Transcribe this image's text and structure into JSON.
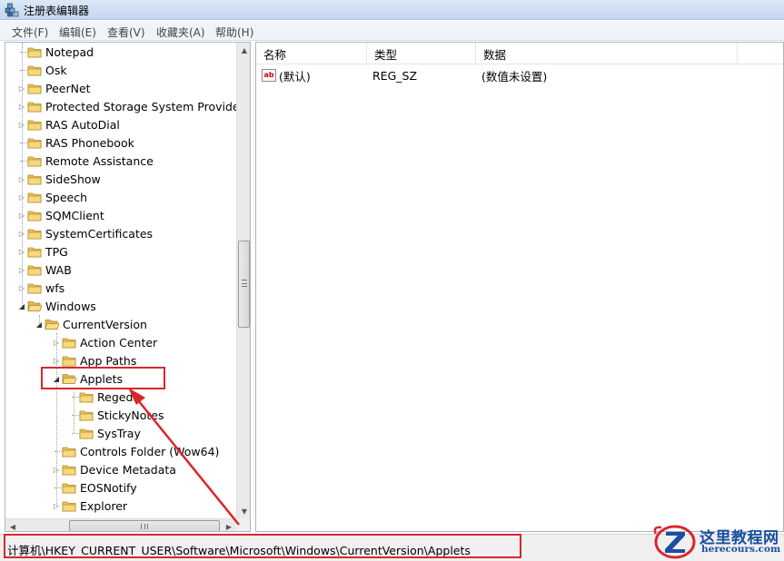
{
  "window": {
    "title": "注册表编辑器"
  },
  "menu": [
    "文件(F)",
    "编辑(E)",
    "查看(V)",
    "收藏夹(A)",
    "帮助(H)"
  ],
  "tree": [
    {
      "label": "Notepad",
      "level": 1,
      "expander": "none"
    },
    {
      "label": "Osk",
      "level": 1,
      "expander": "none"
    },
    {
      "label": "PeerNet",
      "level": 1,
      "expander": "collapsed"
    },
    {
      "label": "Protected Storage System Provider",
      "level": 1,
      "expander": "collapsed"
    },
    {
      "label": "RAS AutoDial",
      "level": 1,
      "expander": "collapsed"
    },
    {
      "label": "RAS Phonebook",
      "level": 1,
      "expander": "none"
    },
    {
      "label": "Remote Assistance",
      "level": 1,
      "expander": "none"
    },
    {
      "label": "SideShow",
      "level": 1,
      "expander": "collapsed"
    },
    {
      "label": "Speech",
      "level": 1,
      "expander": "collapsed"
    },
    {
      "label": "SQMClient",
      "level": 1,
      "expander": "collapsed"
    },
    {
      "label": "SystemCertificates",
      "level": 1,
      "expander": "collapsed"
    },
    {
      "label": "TPG",
      "level": 1,
      "expander": "collapsed"
    },
    {
      "label": "WAB",
      "level": 1,
      "expander": "collapsed"
    },
    {
      "label": "wfs",
      "level": 1,
      "expander": "collapsed"
    },
    {
      "label": "Windows",
      "level": 1,
      "expander": "expanded"
    },
    {
      "label": "CurrentVersion",
      "level": 2,
      "expander": "expanded"
    },
    {
      "label": "Action Center",
      "level": 3,
      "expander": "collapsed"
    },
    {
      "label": "App Paths",
      "level": 3,
      "expander": "collapsed"
    },
    {
      "label": "Applets",
      "level": 3,
      "expander": "expanded"
    },
    {
      "label": "Regedit",
      "level": 4,
      "expander": "none"
    },
    {
      "label": "StickyNotes",
      "level": 4,
      "expander": "none"
    },
    {
      "label": "SysTray",
      "level": 4,
      "expander": "none"
    },
    {
      "label": "Controls Folder (Wow64)",
      "level": 3,
      "expander": "none"
    },
    {
      "label": "Device Metadata",
      "level": 3,
      "expander": "collapsed"
    },
    {
      "label": "EOSNotify",
      "level": 3,
      "expander": "none"
    },
    {
      "label": "Explorer",
      "level": 3,
      "expander": "collapsed"
    }
  ],
  "list": {
    "columns": [
      "名称",
      "类型",
      "数据"
    ],
    "rows": [
      {
        "name": "(默认)",
        "type": "REG_SZ",
        "data": "(数值未设置)",
        "icon": "string-value-icon"
      }
    ]
  },
  "status": {
    "path": "计算机\\HKEY_CURRENT_USER\\Software\\Microsoft\\Windows\\CurrentVersion\\Applets"
  },
  "watermark": {
    "title": "这里教程网",
    "url": "herecours.com"
  },
  "colors": {
    "annotation": "#d9262c",
    "folder": "#e8c35a",
    "brand": "#1b4fa0"
  }
}
